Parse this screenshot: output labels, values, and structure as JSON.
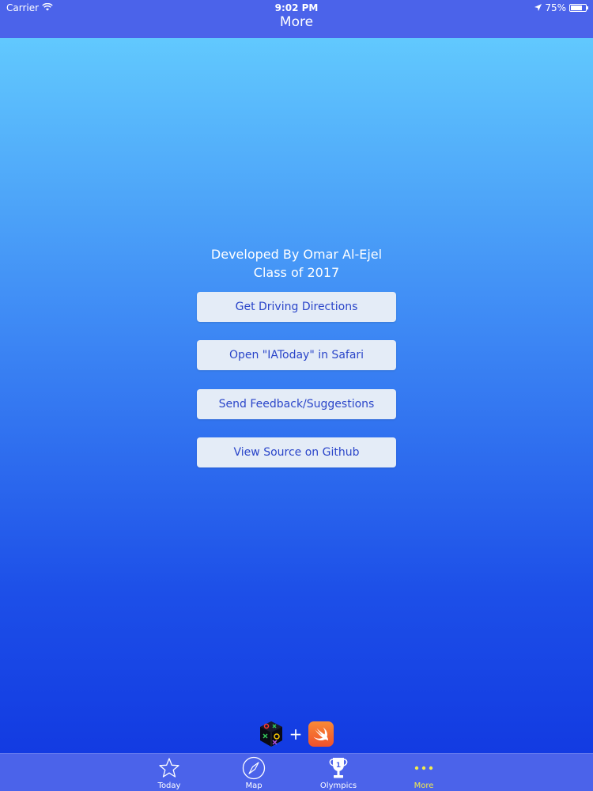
{
  "status_bar": {
    "carrier": "Carrier",
    "time": "9:02 PM",
    "battery": "75%",
    "battery_level": 0.75
  },
  "nav": {
    "title": "More"
  },
  "credits": {
    "line1": "Developed By Omar Al-Ejel",
    "line2": "Class of 2017"
  },
  "buttons": [
    {
      "label": "Get Driving Directions"
    },
    {
      "label": "Open \"IAToday\" in Safari"
    },
    {
      "label": "Send Feedback/Suggestions"
    },
    {
      "label": "View Source on Github"
    }
  ],
  "logos": {
    "plus": "+",
    "icons": [
      "cube-logo-icon",
      "swift-logo-icon"
    ]
  },
  "tabbar": {
    "tabs": [
      {
        "label": "Today",
        "icon": "star-icon"
      },
      {
        "label": "Map",
        "icon": "compass-icon"
      },
      {
        "label": "Olympics",
        "icon": "trophy-icon"
      },
      {
        "label": "More",
        "icon": "more-dots-icon",
        "active": true
      }
    ]
  },
  "colors": {
    "bar": "#4b63ea",
    "button_bg": "#e4ecf7",
    "button_text": "#2a45c9",
    "active_tab": "#f4ed4a",
    "gradient_top": "#66d1ff",
    "gradient_bottom": "#1036e0"
  }
}
